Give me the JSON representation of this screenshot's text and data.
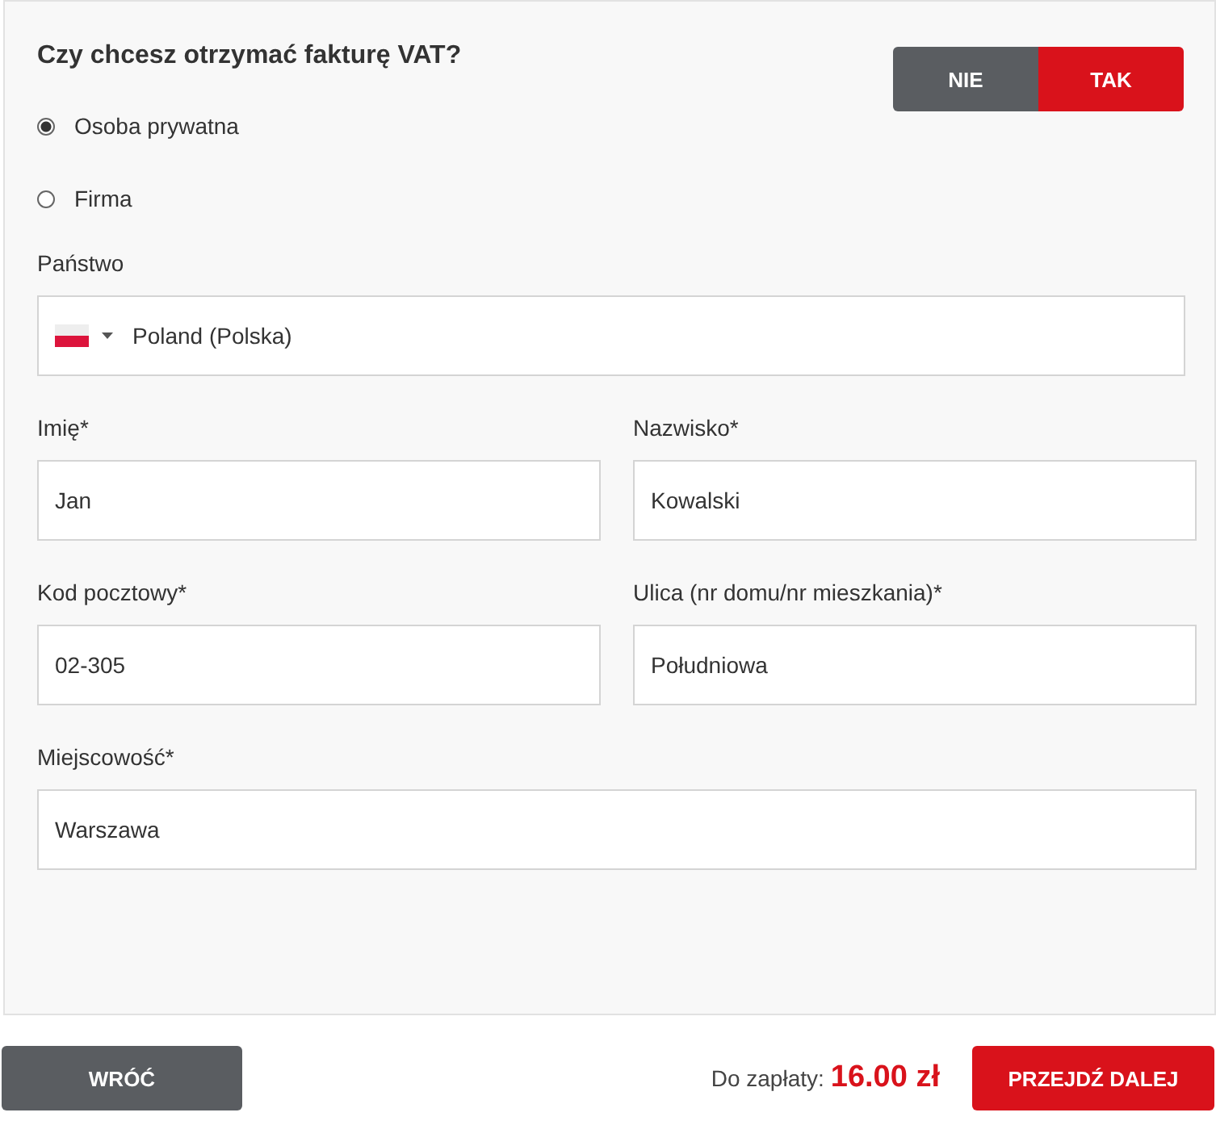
{
  "question": "Czy chcesz otrzymać fakturę VAT?",
  "toggle": [
    {
      "label": "NIE",
      "selected": false
    },
    {
      "label": "TAK",
      "selected": true
    }
  ],
  "customer_types": [
    {
      "label": "Osoba prywatna",
      "selected": true
    },
    {
      "label": "Firma",
      "selected": false
    }
  ],
  "country": {
    "label": "Państwo",
    "value": "Poland (Polska)"
  },
  "fields": [
    {
      "label": "Imię*",
      "value": "Jan",
      "wide": false
    },
    {
      "label": "Nazwisko*",
      "value": "Kowalski",
      "wide": false
    },
    {
      "label": "Kod pocztowy*",
      "value": "02-305",
      "wide": false
    },
    {
      "label": "Ulica (nr domu/nr mieszkania)*",
      "value": "Południowa",
      "wide": false
    },
    {
      "label": "Miejscowość*",
      "value": "Warszawa",
      "wide": true
    }
  ],
  "footer": {
    "back": "WRÓĆ",
    "total_label": "Do zapłaty:",
    "total": "16.00 zł",
    "next": "PRZEJDŹ DALEJ"
  }
}
